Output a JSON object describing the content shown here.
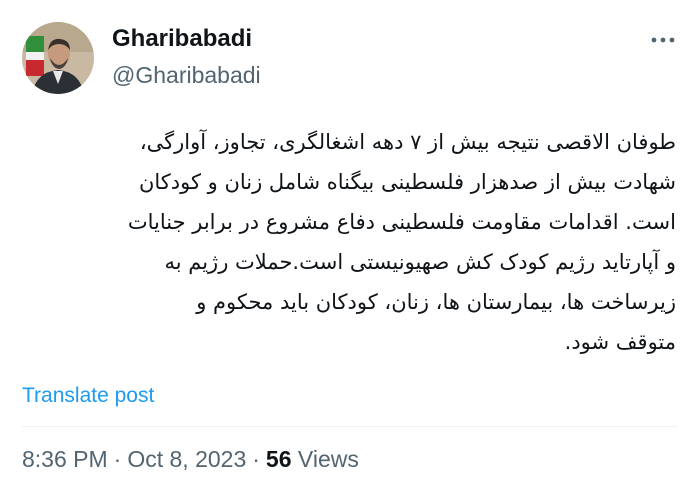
{
  "author": {
    "display_name": "Gharibabadi",
    "handle": "@Gharibabadi",
    "avatar_icon": "profile-photo"
  },
  "menu": {
    "more_icon": "more-horizontal-icon"
  },
  "post": {
    "lines": [
      "طوفان الاقصی نتیجه بیش از ۷ دهه اشغالگری، تجاوز، آوارگی،",
      "شهادت بیش از صدهزار فلسطینی بیگناه شامل زنان و کودکان",
      "است. اقدامات مقاومت فلسطینی دفاع مشروع در برابر جنایات",
      "و آپارتاید رژیم کودک کش صهیونیستی است.حملات رژیم به",
      "زیرساخت ها، بیمارستان ها، زنان، کودکان باید محکوم و",
      "متوقف شود."
    ],
    "translate_label": "Translate post"
  },
  "meta": {
    "time": "8:36 PM",
    "separator": "·",
    "date": "Oct 8, 2023",
    "views_count": "56",
    "views_label": "Views"
  },
  "colors": {
    "text": "#0f1419",
    "secondary": "#536471",
    "link": "#1d9bf0",
    "divider": "#eff3f4"
  }
}
